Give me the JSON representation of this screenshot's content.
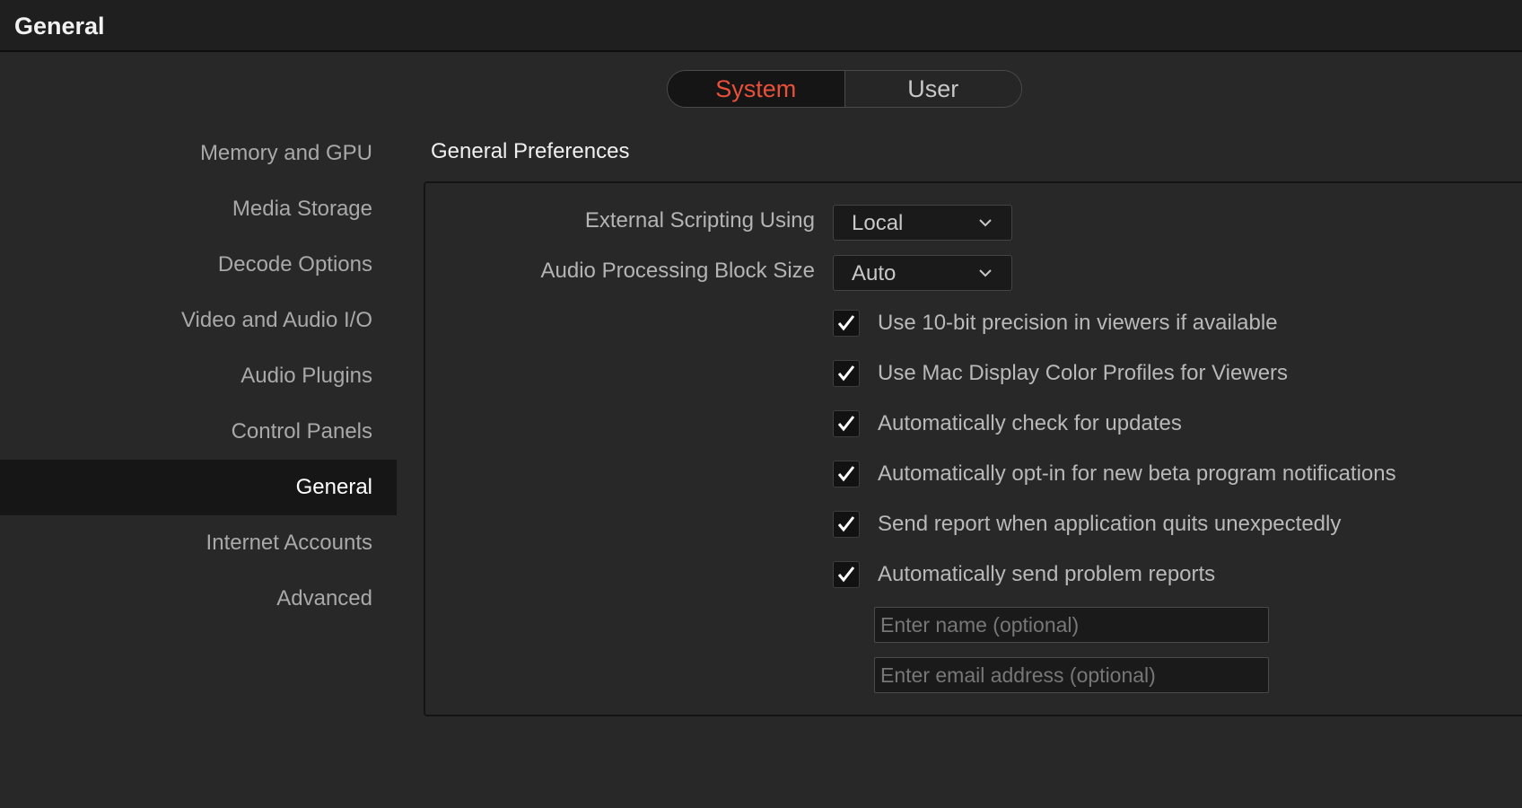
{
  "window": {
    "title": "General"
  },
  "tabs": [
    {
      "label": "System",
      "active": true
    },
    {
      "label": "User",
      "active": false
    }
  ],
  "sidebar": {
    "items": [
      {
        "label": "Memory and GPU"
      },
      {
        "label": "Media Storage"
      },
      {
        "label": "Decode Options"
      },
      {
        "label": "Video and Audio I/O"
      },
      {
        "label": "Audio Plugins"
      },
      {
        "label": "Control Panels"
      },
      {
        "label": "General",
        "active": true
      },
      {
        "label": "Internet Accounts"
      },
      {
        "label": "Advanced"
      }
    ]
  },
  "main": {
    "section_title": "General Preferences",
    "external_scripting": {
      "label": "External Scripting Using",
      "value": "Local"
    },
    "audio_block_size": {
      "label": "Audio Processing Block Size",
      "value": "Auto"
    },
    "checkboxes": [
      {
        "label": "Use 10-bit precision in viewers if available",
        "checked": true
      },
      {
        "label": "Use Mac Display Color Profiles for Viewers",
        "checked": true
      },
      {
        "label": "Automatically check for updates",
        "checked": true
      },
      {
        "label": "Automatically opt-in for new beta program notifications",
        "checked": true
      },
      {
        "label": "Send report when application quits unexpectedly",
        "checked": true
      },
      {
        "label": "Automatically send problem reports",
        "checked": true
      }
    ],
    "name_input": {
      "value": "",
      "placeholder": "Enter name (optional)"
    },
    "email_input": {
      "value": "",
      "placeholder": "Enter email address (optional)"
    }
  },
  "colors": {
    "accent": "#e8503a",
    "background": "#282828",
    "titlebar": "#1f1f1f"
  },
  "icons": {
    "dropdown": "chevron-down-icon",
    "checkbox": "checkmark-icon"
  }
}
